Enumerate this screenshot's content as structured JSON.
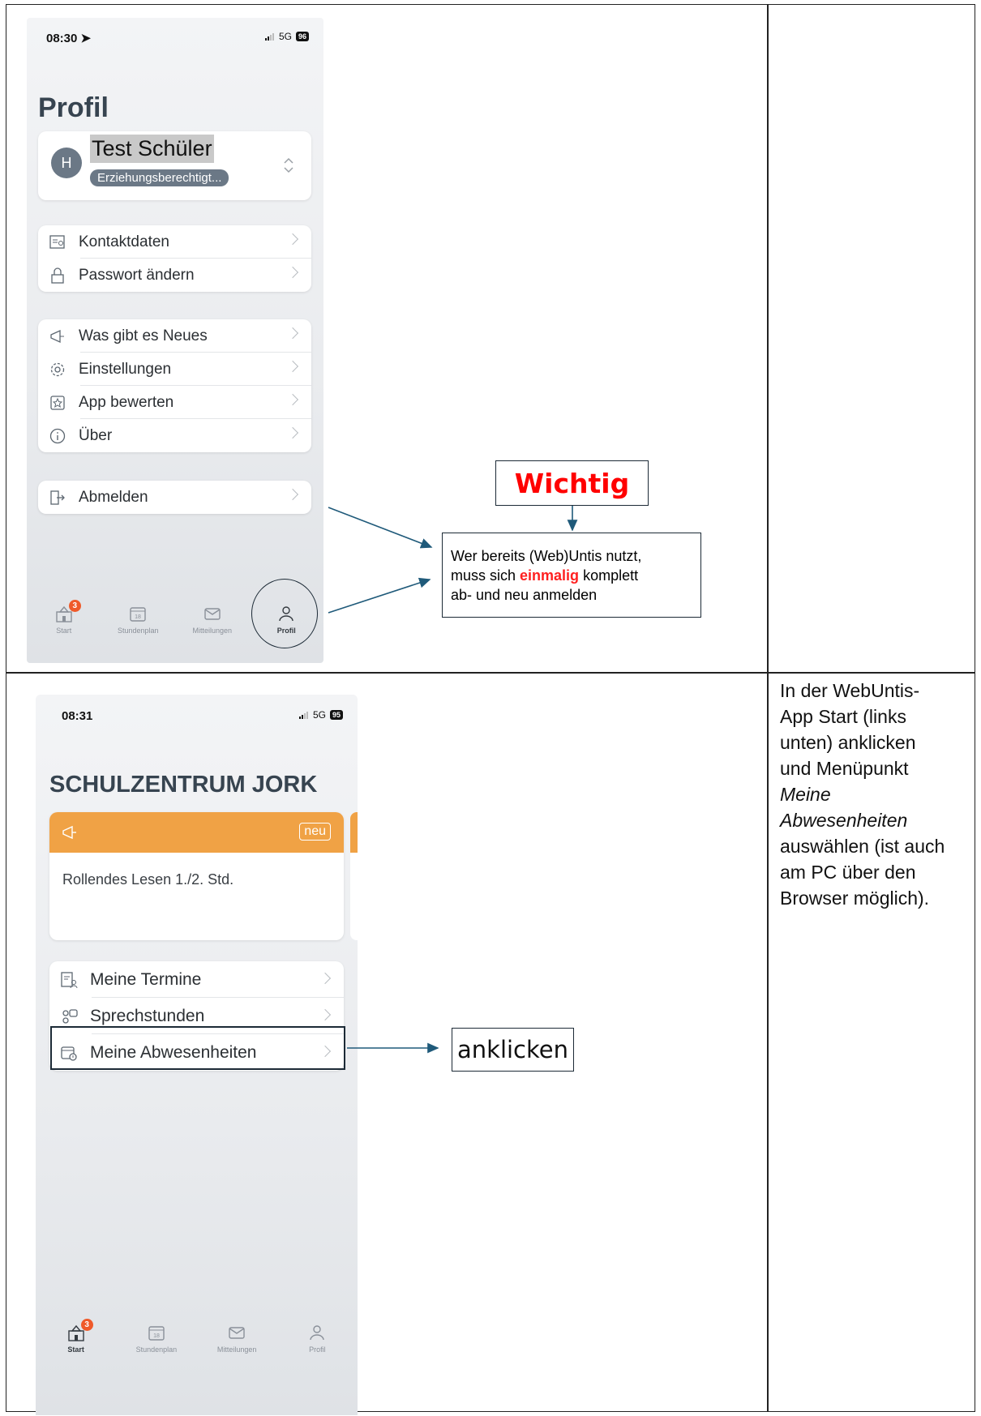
{
  "top": {
    "status": {
      "time": "08:30",
      "network": "5G",
      "battery": "96"
    },
    "title": "Profil",
    "user": {
      "initial": "H",
      "name": "Test Schüler",
      "role": "Erziehungsberechtigt..."
    },
    "group1": [
      {
        "label": "Kontaktdaten",
        "icon": "contact-card-icon"
      },
      {
        "label": "Passwort ändern",
        "icon": "lock-icon"
      }
    ],
    "group2": [
      {
        "label": "Was gibt es Neues",
        "icon": "megaphone-icon"
      },
      {
        "label": "Einstellungen",
        "icon": "gear-icon"
      },
      {
        "label": "App bewerten",
        "icon": "star-icon"
      },
      {
        "label": "Über",
        "icon": "info-icon"
      }
    ],
    "group3": [
      {
        "label": "Abmelden",
        "icon": "logout-icon"
      }
    ],
    "tabs": [
      {
        "label": "Start",
        "badge": "3"
      },
      {
        "label": "Stundenplan",
        "day": "18"
      },
      {
        "label": "Mitteilungen"
      },
      {
        "label": "Profil"
      }
    ],
    "annotation": {
      "important": "Wichtig",
      "note_part1": "Wer bereits (Web)Untis nutzt,",
      "note_part2": "muss sich ",
      "note_emph": "einmalig",
      "note_part3": " komplett",
      "note_part4": "ab- und neu anmelden"
    }
  },
  "bottom": {
    "status": {
      "time": "08:31",
      "network": "5G",
      "battery": "95"
    },
    "title": "SCHULZENTRUM JORK",
    "news": {
      "tag": "neu",
      "text": "Rollendes Lesen 1./2. Std."
    },
    "menu": [
      {
        "label": "Meine Termine",
        "icon": "calendar-person-icon"
      },
      {
        "label": "Sprechstunden",
        "icon": "people-icon"
      },
      {
        "label": "Meine Abwesenheiten",
        "icon": "calendar-clock-icon"
      }
    ],
    "tabs": [
      {
        "label": "Start",
        "badge": "3"
      },
      {
        "label": "Stundenplan",
        "day": "18"
      },
      {
        "label": "Mitteilungen"
      },
      {
        "label": "Profil"
      }
    ],
    "annotation": {
      "click": "anklicken"
    },
    "description": {
      "line1": "In der WebUntis-",
      "line2": "App Start (links",
      "line3": "unten) anklicken",
      "line4": "und Menüpunkt",
      "line5": "Meine",
      "line6": "Abwesenheiten",
      "line7": "auswählen (ist auch",
      "line8": "am PC über den",
      "line9": "Browser möglich)."
    }
  },
  "colors": {
    "accent_orange": "#f0a245",
    "badge": "#ef5a2a",
    "important_red": "#ff0000",
    "annotation_line": "#1f5a7a"
  }
}
